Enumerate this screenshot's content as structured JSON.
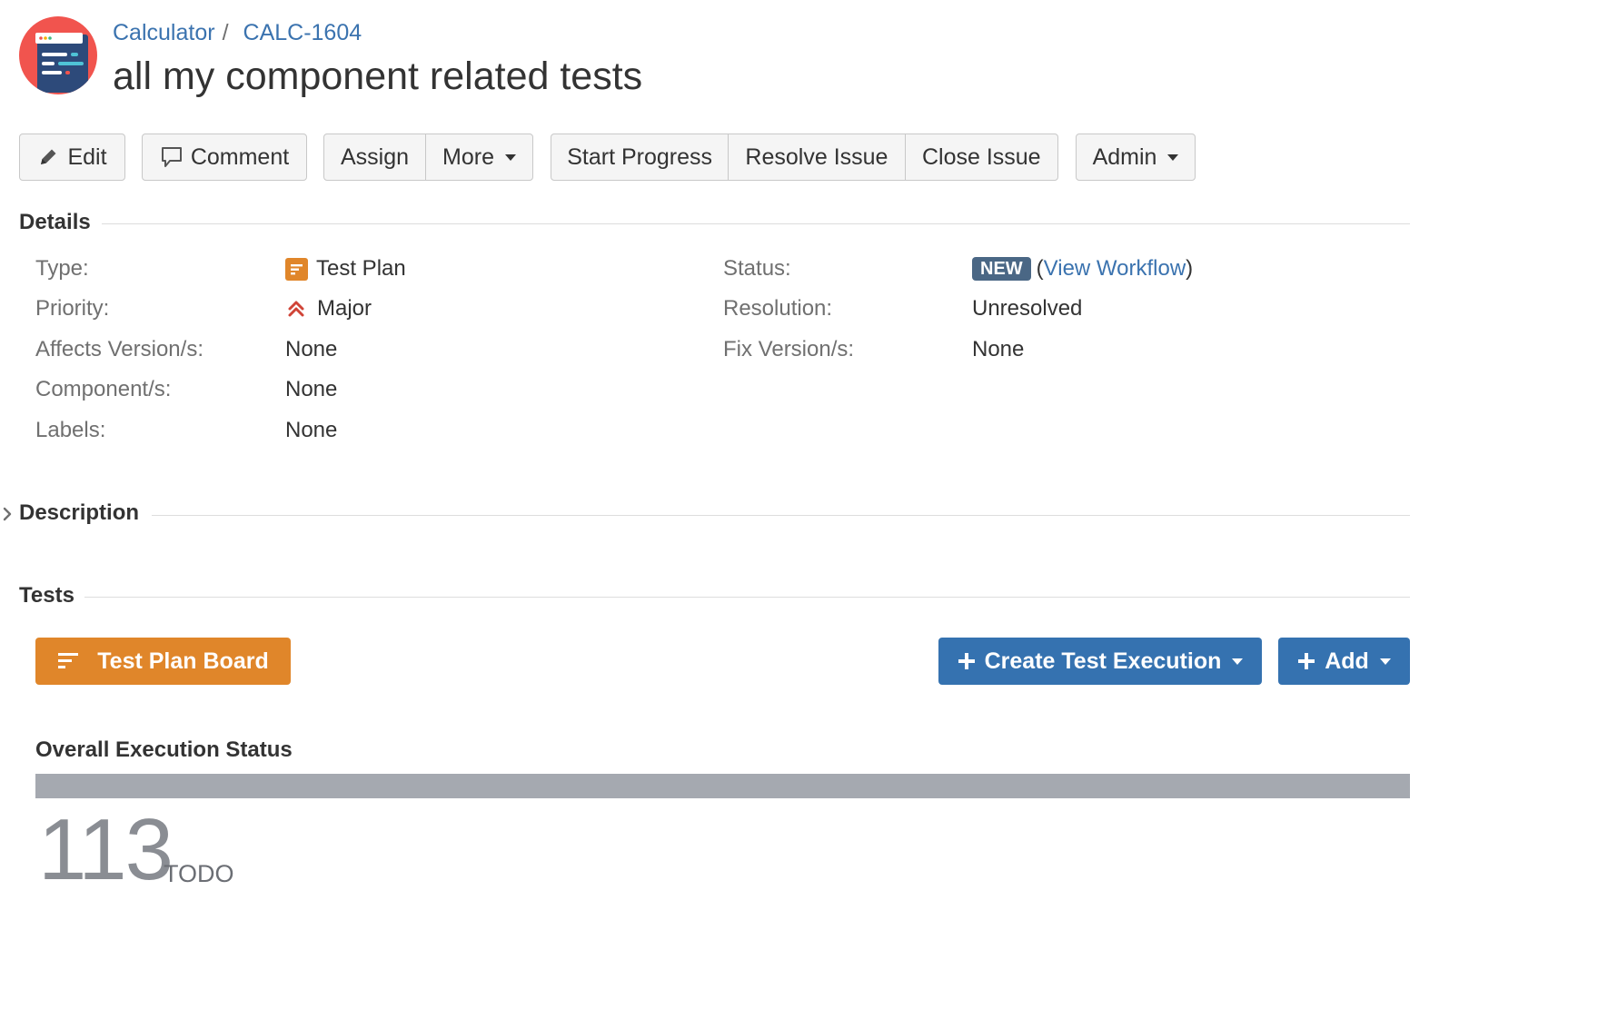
{
  "breadcrumb": {
    "project": "Calculator",
    "separator": "/",
    "issue_key": "CALC-1604"
  },
  "issue": {
    "summary": "all my component related tests"
  },
  "toolbar": {
    "edit": "Edit",
    "comment": "Comment",
    "assign": "Assign",
    "more": "More",
    "start_progress": "Start Progress",
    "resolve_issue": "Resolve Issue",
    "close_issue": "Close Issue",
    "admin": "Admin"
  },
  "details": {
    "heading": "Details",
    "type_label": "Type:",
    "type_value": "Test Plan",
    "priority_label": "Priority:",
    "priority_value": "Major",
    "affects_label": "Affects Version/s:",
    "affects_value": "None",
    "components_label": "Component/s:",
    "components_value": "None",
    "labels_label": "Labels:",
    "labels_value": "None",
    "status_label": "Status:",
    "status_value": "NEW",
    "workflow_open": "(",
    "workflow_link": "View Workflow",
    "workflow_close": ")",
    "resolution_label": "Resolution:",
    "resolution_value": "Unresolved",
    "fix_label": "Fix Version/s:",
    "fix_value": "None"
  },
  "description": {
    "heading": "Description"
  },
  "tests": {
    "heading": "Tests",
    "board_button": "Test Plan Board",
    "create_execution_button": "Create Test Execution",
    "add_button": "Add"
  },
  "execution": {
    "heading": "Overall Execution Status",
    "todo_count": "113",
    "todo_label": "TODO",
    "todo_fraction": 1.0
  },
  "colors": {
    "link": "#3b73af",
    "orange": "#e0862a",
    "primary": "#3572b0",
    "status_new": "#4a6785",
    "todo_bar": "#a5a9b0",
    "priority_major": "#d04437"
  },
  "icons": [
    "project-avatar-icon",
    "pencil-icon",
    "comment-icon",
    "test-plan-type-icon",
    "priority-major-icon",
    "chevron-right-icon",
    "board-icon",
    "plus-icon"
  ]
}
